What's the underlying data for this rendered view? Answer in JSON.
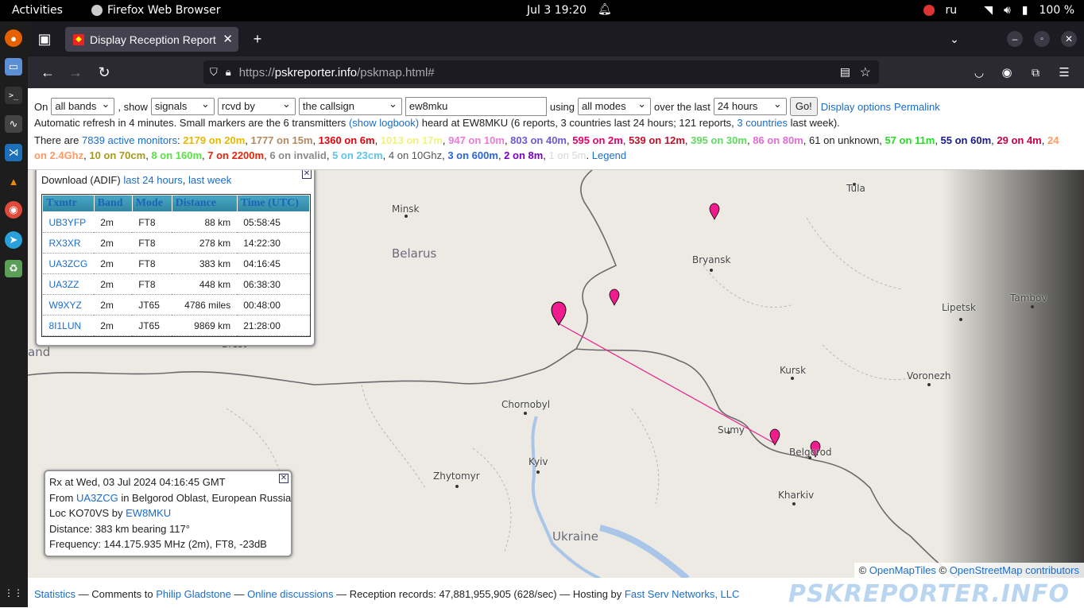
{
  "system": {
    "activities": "Activities",
    "app_name": "Firefox Web Browser",
    "clock": "Jul 3  19:20",
    "lang": "ru",
    "battery": "100 %"
  },
  "browser": {
    "tab_title": "Display Reception Report",
    "url_scheme": "https://",
    "url_host": "pskreporter.info",
    "url_path": "/pskmap.html#"
  },
  "controls": {
    "on_label": "On",
    "bands": "all bands",
    "show_label": ", show",
    "show": "signals",
    "direction": "rcvd by",
    "target": "the callsign",
    "callsign": "ew8mku",
    "using_label": "using",
    "modes": "all modes",
    "over_label": "over the last",
    "period": "24 hours",
    "go": "Go!",
    "display_options": "Display options",
    "permalink": "Permalink"
  },
  "status": {
    "p1": "Automatic refresh in 4 minutes. Small markers are the 6 transmitters",
    "show_logbook": "(show logbook)",
    "p2": "heard at EW8MKU (6 reports, 3 countries last 24 hours; 121 reports,",
    "countries_link": "3 countries",
    "p3": "last week).",
    "there_are": "There are",
    "active_monitors": "7839 active monitors",
    "colon": ":",
    "bands": [
      {
        "text": "2179 on 20m",
        "color": "#e6b800",
        "bold": true
      },
      {
        "text": "1777 on 15m",
        "color": "#b5895f",
        "bold": true
      },
      {
        "text": "1360 on 6m",
        "color": "#e8000b",
        "bold": true
      },
      {
        "text": "1013 on 17m",
        "color": "#f2f27a",
        "bold": true
      },
      {
        "text": "947 on 10m",
        "color": "#ec7ad9",
        "bold": true
      },
      {
        "text": "803 on 40m",
        "color": "#6a5ad9",
        "bold": true
      },
      {
        "text": "595 on 2m",
        "color": "#e5006a",
        "bold": true
      },
      {
        "text": "539 on 12m",
        "color": "#c0112b",
        "bold": true
      },
      {
        "text": "395 on 30m",
        "color": "#62d962",
        "bold": true
      },
      {
        "text": "86 on 80m",
        "color": "#e36bd7",
        "bold": true
      },
      {
        "text": "61 on unknown",
        "color": "#222222",
        "bold": false
      },
      {
        "text": "57 on 11m",
        "color": "#22dd22",
        "bold": true
      },
      {
        "text": "55 on 60m",
        "color": "#1a1a8c",
        "bold": true
      },
      {
        "text": "29 on 4m",
        "color": "#c8004a",
        "bold": true
      },
      {
        "text": "24 on 2.4Ghz",
        "color": "#ff9a66",
        "bold": true
      },
      {
        "text": "10 on 70cm",
        "color": "#a89a1a",
        "bold": true
      },
      {
        "text": "8 on 160m",
        "color": "#57e342",
        "bold": true
      },
      {
        "text": "7 on 2200m",
        "color": "#e8240b",
        "bold": true
      },
      {
        "text": "6 on invalid",
        "color": "#8a8a8a",
        "bold": true
      },
      {
        "text": "5 on 23cm",
        "color": "#5fc5e8",
        "bold": true
      },
      {
        "text": "4 on 10Ghz",
        "color": "#555555",
        "bold": false
      },
      {
        "text": "3 on 600m",
        "color": "#2b63d9",
        "bold": true
      },
      {
        "text": "2 on 8m",
        "color": "#7a00c8",
        "bold": true
      },
      {
        "text": "1 on 5m",
        "color": "#d9d9d9",
        "bold": false
      }
    ],
    "legend": "Legend"
  },
  "reports_popup": {
    "download_label": "Download (ADIF)",
    "last24": "last 24 hours",
    "lastweek": "last week",
    "headers": [
      "Txmtr",
      "Band",
      "Mode",
      "Distance",
      "Time (UTC)"
    ],
    "rows": [
      {
        "txmtr": "UB3YFP",
        "band": "2m",
        "mode": "FT8",
        "distance": "88 km",
        "time": "05:58:45"
      },
      {
        "txmtr": "RX3XR",
        "band": "2m",
        "mode": "FT8",
        "distance": "278 km",
        "time": "14:22:30"
      },
      {
        "txmtr": "UA3ZCG",
        "band": "2m",
        "mode": "FT8",
        "distance": "383 km",
        "time": "04:16:45"
      },
      {
        "txmtr": "UA3ZZ",
        "band": "2m",
        "mode": "FT8",
        "distance": "448 km",
        "time": "06:38:30"
      },
      {
        "txmtr": "W9XYZ",
        "band": "2m",
        "mode": "JT65",
        "distance": "4786 miles",
        "time": "00:48:00"
      },
      {
        "txmtr": "8I1LUN",
        "band": "2m",
        "mode": "JT65",
        "distance": "9869 km",
        "time": "21:28:00"
      }
    ]
  },
  "rx_popup": {
    "line1": "Rx at Wed, 03 Jul 2024 04:16:45 GMT",
    "from": "From",
    "from_call": "UA3ZCG",
    "from_rest": "in Belgorod Oblast, European Russia",
    "loc": "Loc KO70VS by",
    "loc_call": "EW8MKU",
    "distance": "Distance: 383 km bearing 117°",
    "frequency": "Frequency: 144.175.935 MHz (2m), FT8, -23dB"
  },
  "map_labels": {
    "cities": [
      "Minsk",
      "Bryansk",
      "Tula",
      "Lipetsk",
      "Tambov",
      "Kursk",
      "Voronezh",
      "Chornobyl",
      "Sumy",
      "Belgorod",
      "Kyiv",
      "Zhytomyr",
      "Kharkiv",
      "Brest"
    ],
    "countries": [
      "Belarus",
      "Ukraine"
    ],
    "edge": "and"
  },
  "attribution": {
    "copy1": "©",
    "openmaptiles": "OpenMapTiles",
    "copy2": "©",
    "osm": "OpenStreetMap contributors"
  },
  "footer": {
    "statistics": "Statistics",
    "t1": "— Comments to",
    "philip": "Philip Gladstone",
    "t2": "—",
    "online": "Online discussions",
    "t3": "— Reception records: 47,881,955,905 (628/sec) — Hosting by",
    "host": "Fast Serv Networks, LLC",
    "logo": "PSKREPORTER.INFO"
  },
  "colors": {
    "marker": "#ee1c8c",
    "path_line": "#ee1c8c",
    "link": "#1a6dcc"
  }
}
